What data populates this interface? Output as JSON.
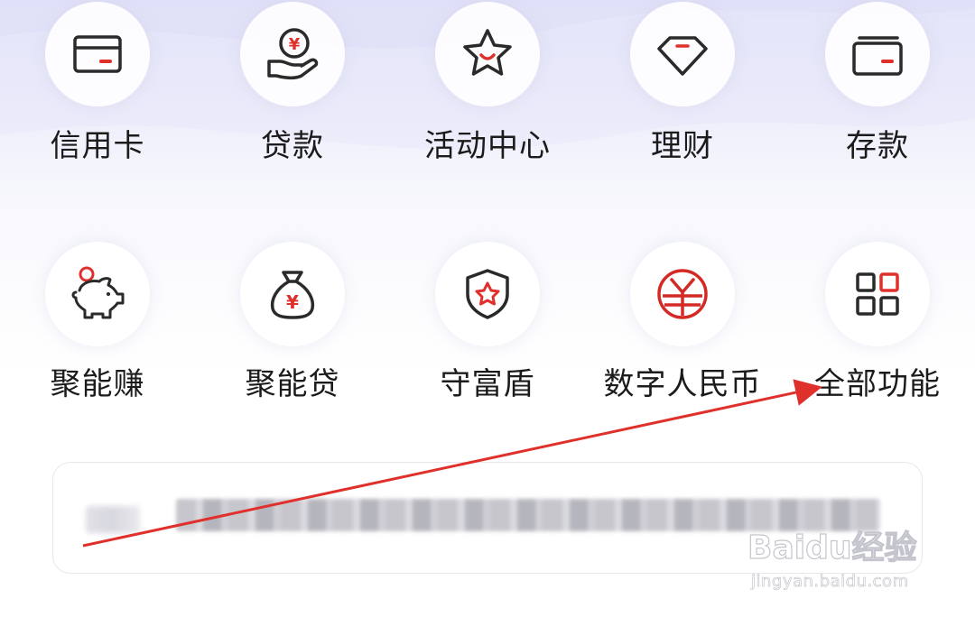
{
  "colors": {
    "accent": "#e0302b",
    "icon_stroke": "#2a2a2a",
    "annotation": "#e0302b"
  },
  "grid": {
    "row1": [
      {
        "label": "信用卡",
        "icon": "credit-card-icon"
      },
      {
        "label": "贷款",
        "icon": "loan-yuan-hand-icon"
      },
      {
        "label": "活动中心",
        "icon": "star-smile-icon"
      },
      {
        "label": "理财",
        "icon": "diamond-icon"
      },
      {
        "label": "存款",
        "icon": "wallet-icon"
      }
    ],
    "row2": [
      {
        "label": "聚能赚",
        "icon": "piggy-bank-icon"
      },
      {
        "label": "聚能贷",
        "icon": "money-bag-icon"
      },
      {
        "label": "守富盾",
        "icon": "shield-star-icon"
      },
      {
        "label": "数字人民币",
        "icon": "digital-yuan-icon"
      },
      {
        "label": "全部功能",
        "icon": "all-functions-grid-icon"
      }
    ]
  },
  "watermark": {
    "brand": "Baidu经验",
    "site": "jingyan.baidu.com"
  }
}
